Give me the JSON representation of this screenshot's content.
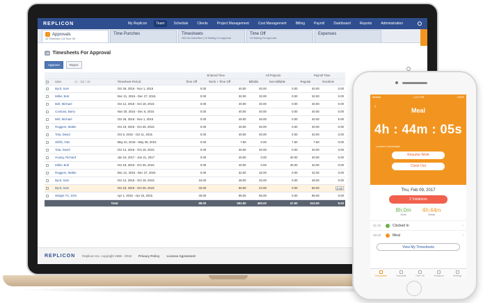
{
  "app": {
    "brand": "REPLICON",
    "topnav": [
      {
        "label": "My Replicon"
      },
      {
        "label": "Team",
        "active": true
      },
      {
        "label": "Schedule"
      },
      {
        "label": "Clients"
      },
      {
        "label": "Project Management"
      },
      {
        "label": "Cost Management"
      },
      {
        "label": "Billing"
      },
      {
        "label": "Payroll"
      },
      {
        "label": "Dashboard"
      },
      {
        "label": "Reports"
      },
      {
        "label": "Administration"
      }
    ],
    "tabs": [
      {
        "label": "Approvals",
        "badge": "16",
        "sub": "15 Timesheet | 16 Time Off",
        "active": true
      },
      {
        "label": "Time Punches",
        "sub": ""
      },
      {
        "label": "Timesheets",
        "sub": "365 Not Submitted | 15 Waiting For Approval"
      },
      {
        "label": "Time Off",
        "sub": "15 Waiting For Approval"
      },
      {
        "label": "Expenses",
        "sub": ""
      }
    ]
  },
  "page": {
    "count": "15",
    "title": "Timesheets For Approval",
    "approve": "Approve",
    "reject": "Reject",
    "group_headers": {
      "entered": "Entered Time",
      "projects": "All Projects",
      "payroll": "Payroll Time"
    },
    "columns": [
      "User",
      "(1 - 15) / 15",
      "Timesheet Period",
      "Time Off",
      "Work + Time Off",
      "Billable",
      "Non-Billable",
      "Regular",
      "Overtime"
    ],
    "rows": [
      [
        "Byrd, Sam",
        "Oct 26, 2015 - Nov 1, 2015",
        "0.00",
        "40.00",
        "40.00",
        "0.00",
        "40.00",
        "0.00"
      ],
      [
        "Miller, Bob",
        "Dec 21, 2015 - Dec 27, 2015",
        "0.00",
        "32.00",
        "32.00",
        "0.00",
        "32.00",
        "0.00"
      ],
      [
        "Bell, Michael",
        "Oct 12, 2015 - Oct 18, 2015",
        "0.00",
        "40.00",
        "40.00",
        "0.00",
        "40.00",
        "0.00"
      ],
      [
        "Cordova, Barry",
        "Nov 30, 2015 - Dec 6, 2015",
        "0.00",
        "40.00",
        "40.00",
        "0.00",
        "40.00",
        "0.00"
      ],
      [
        "Bell, Michael",
        "Oct 26, 2015 - Nov 1, 2015",
        "0.00",
        "45.00",
        "45.00",
        "0.00",
        "40.00",
        "5.00"
      ],
      [
        "Roggers, Mattie",
        "Oct 19, 2015 - Oct 25, 2015",
        "0.00",
        "40.00",
        "40.00",
        "0.00",
        "40.00",
        "0.00"
      ],
      [
        "Tota, David",
        "Oct 5, 2015 - Oct 11, 2015",
        "0.00",
        "40.00",
        "40.00",
        "0.00",
        "40.00",
        "0.00"
      ],
      [
        "Shifts, Otto",
        "May 22, 2016 - May 28, 2016",
        "0.00",
        "7.50",
        "0.00",
        "7.50",
        "7.50",
        "0.00"
      ],
      [
        "Tota, David",
        "Oct 12, 2015 - Oct 18, 2015",
        "0.00",
        "40.00",
        "40.00",
        "0.00",
        "40.00",
        "0.00"
      ],
      [
        "Huang, Richard",
        "Jan 15, 2017 - Jan 21, 2017",
        "0.00",
        "40.00",
        "0.00",
        "40.00",
        "40.00",
        "0.00"
      ],
      [
        "Miller, Bob",
        "Oct 19, 2015 - Oct 25, 2015",
        "0.00",
        "40.00",
        "0.00",
        "40.00",
        "40.00",
        "0.00"
      ],
      [
        "Roggers, Mattie",
        "Dec 21, 2015 - Dec 27, 2015",
        "0.00",
        "32.00",
        "32.00",
        "0.00",
        "32.00",
        "0.00"
      ],
      [
        "Byrd, Sam",
        "Oct 12, 2015 - Oct 18, 2015",
        "16.00",
        "48.00",
        "32.00",
        "0.00",
        "48.00",
        "0.00"
      ],
      [
        "Byrd, Sam",
        "Oct 19, 2015 - Oct 25, 2015",
        "32.00",
        "56.00",
        "24.00",
        "0.00",
        "56.00",
        "0.00"
      ],
      [
        "Widget T3, John",
        "Apr 1, 2016 - Apr 15, 2016",
        "40.00",
        "96.00",
        "56.00",
        "0.00",
        "96.00",
        "0.00"
      ]
    ],
    "highlight_row": 13,
    "total": {
      "label": "Total",
      "values": [
        "88.00",
        "592.50",
        "460.00",
        "47.50",
        "512.50",
        "8.00"
      ]
    }
  },
  "footer": {
    "brand": "REPLICON",
    "copyright": "Replicon Inc. copyright 1996 - 2016",
    "privacy": "Privacy Policy",
    "license": "License Agreement"
  },
  "phone": {
    "status_left": "●●●●● ",
    "status_center": "4:21 PM",
    "status_right": "100%",
    "back": "‹",
    "title": "Meal",
    "timer": "4h : 44m : 05s",
    "location": "Location Unavailable",
    "resume": "Resume Work",
    "clockout": "Clock Out",
    "date": "Thu, Feb 09, 2017",
    "violations": "2 Violations",
    "work_val": "8h:0m",
    "work_label": "Work",
    "break_val": "4h:44m",
    "break_label": "Break",
    "rows": [
      {
        "time": "01:00",
        "label": "Clocked In",
        "color": "#6ab04c"
      },
      {
        "time": "09:00",
        "label": "Meal",
        "color": "#f29520"
      }
    ],
    "view": "View My Timesheets",
    "nav": [
      {
        "label": "Timesheets",
        "active": true
      },
      {
        "label": "Schedule"
      },
      {
        "label": "Time Off"
      },
      {
        "label": "Violations"
      },
      {
        "label": "Settings"
      }
    ],
    "colors": {
      "accent": "#f29520",
      "primary": "#2f4e8f"
    }
  }
}
